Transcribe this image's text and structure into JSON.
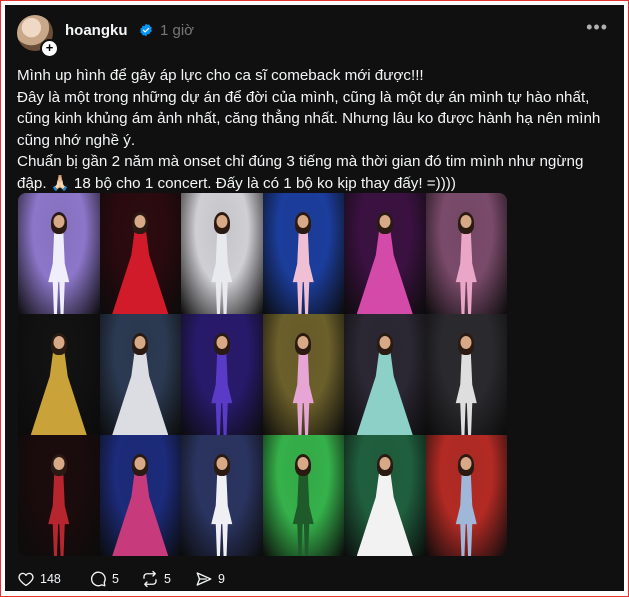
{
  "post": {
    "username": "hoangku",
    "time": "1 giờ",
    "paragraphs": [
      "Mình up hình để gây áp lực cho ca sĩ comeback mới được!!!",
      "Đây là một trong những dự án để đời của mình, cũng là một dự án mình tự hào nhất, cũng kinh khủng ám ảnh nhất, căng thẳng nhất. Nhưng lâu ko được hành hạ nên mình cũng nhớ nghề ý.",
      "Chuẩn bị gần 2 năm mà onset chỉ đúng 3 tiếng mà thời gian đó tim mình như ngừng đập. 🙏🏻 18 bộ cho 1 concert. Đấy là có 1 bộ ko kịp thay đấy! =))))"
    ]
  },
  "photos": [
    {
      "bg": "#8c76c9",
      "dress": "#f1eefb",
      "label": "white-gown"
    },
    {
      "bg": "#2a0a0e",
      "dress": "#d11a2a",
      "label": "red-ballgown"
    },
    {
      "bg": "#cfcfd4",
      "dress": "#e8e8ef",
      "label": "silver-flowing-dress"
    },
    {
      "bg": "#1b3d9c",
      "dress": "#f0bfd3",
      "label": "pink-mini-dress"
    },
    {
      "bg": "#3a1140",
      "dress": "#d44aa8",
      "label": "magenta-corset"
    },
    {
      "bg": "#7a4a6a",
      "dress": "#e9a6c7",
      "label": "pink-feather-gown"
    },
    {
      "bg": "#111111",
      "dress": "#c9a23a",
      "label": "gold-sculpture-gown"
    },
    {
      "bg": "#2b3a52",
      "dress": "#dcdde3",
      "label": "white-wing-gown"
    },
    {
      "bg": "#281a6b",
      "dress": "#5a3bc8",
      "label": "purple-embellished-gown"
    },
    {
      "bg": "#6b5f2a",
      "dress": "#e7a5d6",
      "label": "lavender-tutu"
    },
    {
      "bg": "#2b2733",
      "dress": "#8dd0c7",
      "label": "teal-harem-outfit"
    },
    {
      "bg": "#2a2a2e",
      "dress": "#dedede",
      "label": "black-white-ruffle"
    },
    {
      "bg": "#1a0b0c",
      "dress": "#b7262f",
      "label": "red-polka-skirt"
    },
    {
      "bg": "#1c2b7a",
      "dress": "#c73b7d",
      "label": "patchwork-mini"
    },
    {
      "bg": "#2a3460",
      "dress": "#f0f0f4",
      "label": "white-tiered-dress"
    },
    {
      "bg": "#35b14a",
      "dress": "#1f5a2a",
      "label": "green-stage-outfit"
    },
    {
      "bg": "#1f5f3e",
      "dress": "#f2f2f2",
      "label": "black-white-patterned"
    },
    {
      "bg": "#b32a24",
      "dress": "#9fb7d8",
      "label": "denim-outfit"
    }
  ],
  "actions": {
    "likes": "148",
    "comments": "5",
    "reposts": "5",
    "shares": "9"
  },
  "colors": {
    "background": "#101010",
    "text": "#f3f5f7",
    "muted": "#777777",
    "verified": "#0095f6"
  }
}
